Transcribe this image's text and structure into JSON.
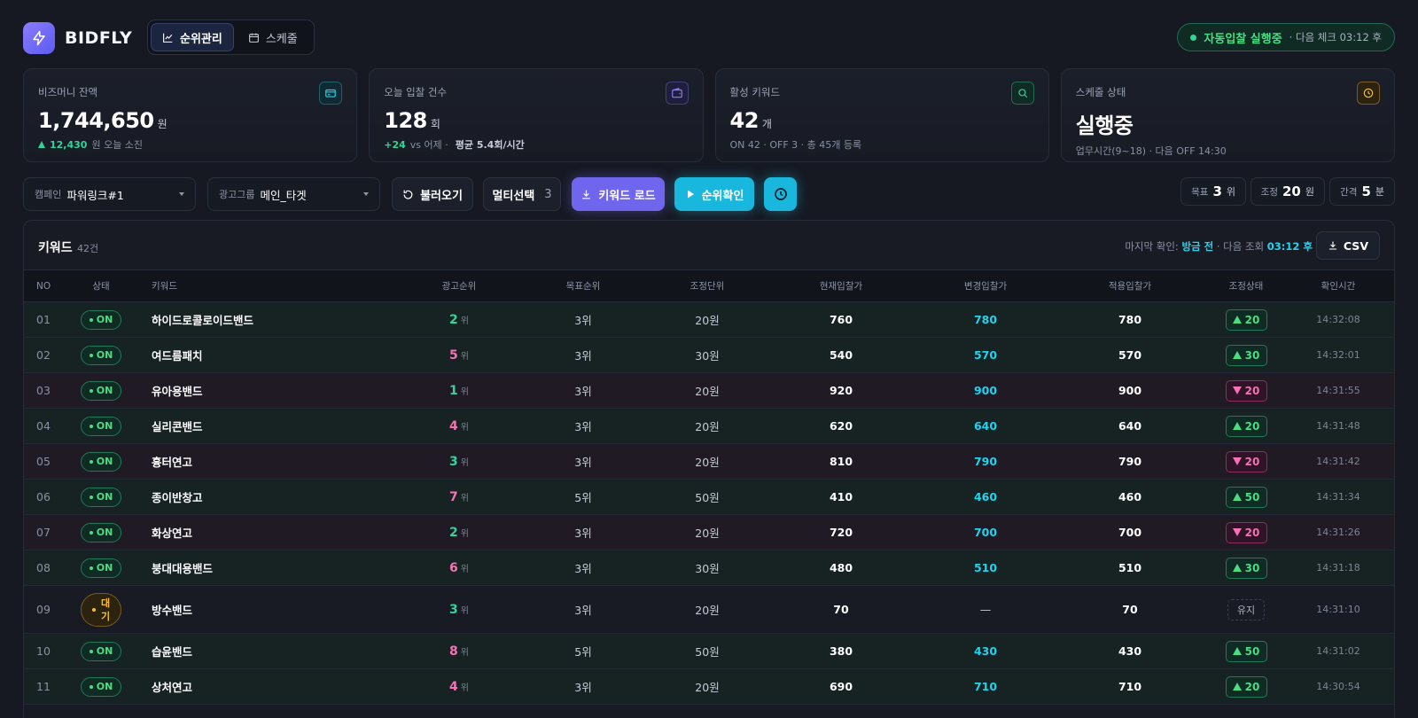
{
  "app": {
    "brand": "BIDFLY",
    "tabs": [
      {
        "label": "순위관리",
        "icon": "chart-line-icon",
        "active": true
      },
      {
        "label": "스케줄",
        "icon": "calendar-icon",
        "active": false
      }
    ],
    "status": {
      "main": "자동입찰 실행중",
      "sub": "· 다음 체크 03:12 후"
    }
  },
  "cards": [
    {
      "label": "비즈머니 잔액",
      "value": "1,744,650",
      "unit": "원",
      "sub_value": "12,430",
      "sub_text": "원 오늘 소진",
      "icon": "card-icon",
      "accent": "#22d3ee"
    },
    {
      "label": "오늘 입찰 건수",
      "value": "128",
      "unit": "회",
      "sub_value": "+24",
      "sub_text": "vs 어제 ·",
      "sub_extra": "평균 5.4회/시간",
      "icon": "wallet-icon",
      "accent": "#8b7cff"
    },
    {
      "label": "활성 키워드",
      "value": "42",
      "unit": "개",
      "sub_text": "ON 42 · OFF 3 · 총 45개 등록",
      "icon": "search-icon",
      "accent": "#34d399"
    },
    {
      "label": "스케줄 상태",
      "value": "실행중",
      "sub_text": "업무시간(9~18) · 다음 OFF 14:30",
      "icon": "clock-icon",
      "accent": "#fbbf24"
    }
  ],
  "toolbar": {
    "campaign_label": "캠페인",
    "campaign_value": "파워링크#1",
    "group_label": "광고그룹",
    "group_value": "메인_타겟",
    "load_label": "불러오기",
    "multi_label": "멀티선택",
    "multi_count": "3",
    "keyword_load_label": "키워드 로드",
    "rank_check_label": "순위확인",
    "chips": [
      {
        "label": "목표",
        "value": "3",
        "unit": "위"
      },
      {
        "label": "조정",
        "value": "20",
        "unit": "원"
      },
      {
        "label": "간격",
        "value": "5",
        "unit": "분"
      }
    ]
  },
  "table": {
    "title": "키워드",
    "count": "42건",
    "last_check_prefix": "마지막 확인:",
    "last_check_value": "방금 전",
    "next_check_prefix": "· 다음 조회",
    "next_check_value": "03:12 후",
    "csv_label": "CSV",
    "columns": [
      "NO",
      "상태",
      "키워드",
      "광고순위",
      "목표순위",
      "조정단위",
      "현재입찰가",
      "변경입찰가",
      "적용입찰가",
      "조정상태",
      "확인시간"
    ],
    "rank_unit": "위",
    "rows": [
      {
        "no": "01",
        "state": "ON",
        "keyword": "하이드로콜로이드밴드",
        "rank": "2",
        "goal": "3위",
        "unit": "20원",
        "current": "760",
        "changed": "780",
        "applied": "780",
        "adj_dir": "up",
        "adj": "20",
        "time": "14:32:08"
      },
      {
        "no": "02",
        "state": "ON",
        "keyword": "여드름패치",
        "rank": "5",
        "goal": "3위",
        "unit": "30원",
        "current": "540",
        "changed": "570",
        "applied": "570",
        "adj_dir": "up",
        "adj": "30",
        "time": "14:32:01"
      },
      {
        "no": "03",
        "state": "ON",
        "keyword": "유아용밴드",
        "rank": "1",
        "goal": "3위",
        "unit": "20원",
        "current": "920",
        "changed": "900",
        "applied": "900",
        "adj_dir": "down",
        "adj": "20",
        "time": "14:31:55"
      },
      {
        "no": "04",
        "state": "ON",
        "keyword": "실리콘밴드",
        "rank": "4",
        "goal": "3위",
        "unit": "20원",
        "current": "620",
        "changed": "640",
        "applied": "640",
        "adj_dir": "up",
        "adj": "20",
        "time": "14:31:48"
      },
      {
        "no": "05",
        "state": "ON",
        "keyword": "흉터연고",
        "rank": "3",
        "goal": "3위",
        "unit": "20원",
        "current": "810",
        "changed": "790",
        "applied": "790",
        "adj_dir": "down",
        "adj": "20",
        "time": "14:31:42"
      },
      {
        "no": "06",
        "state": "ON",
        "keyword": "종이반창고",
        "rank": "7",
        "goal": "5위",
        "unit": "50원",
        "current": "410",
        "changed": "460",
        "applied": "460",
        "adj_dir": "up",
        "adj": "50",
        "time": "14:31:34"
      },
      {
        "no": "07",
        "state": "ON",
        "keyword": "화상연고",
        "rank": "2",
        "goal": "3위",
        "unit": "20원",
        "current": "720",
        "changed": "700",
        "applied": "700",
        "adj_dir": "down",
        "adj": "20",
        "time": "14:31:26"
      },
      {
        "no": "08",
        "state": "ON",
        "keyword": "붕대대용밴드",
        "rank": "6",
        "goal": "3위",
        "unit": "30원",
        "current": "480",
        "changed": "510",
        "applied": "510",
        "adj_dir": "up",
        "adj": "30",
        "time": "14:31:18"
      },
      {
        "no": "09",
        "state": "대기",
        "state_line1": "대",
        "state_line2": "기",
        "keyword": "방수밴드",
        "rank": "3",
        "goal": "3위",
        "unit": "20원",
        "current": "70",
        "changed": "—",
        "applied": "70",
        "adj_dir": "keep",
        "adj": "유지",
        "time": "14:31:10"
      },
      {
        "no": "10",
        "state": "ON",
        "keyword": "습윤밴드",
        "rank": "8",
        "goal": "5위",
        "unit": "50원",
        "current": "380",
        "changed": "430",
        "applied": "430",
        "adj_dir": "up",
        "adj": "50",
        "time": "14:31:02"
      },
      {
        "no": "11",
        "state": "ON",
        "keyword": "상처연고",
        "rank": "4",
        "goal": "3위",
        "unit": "20원",
        "current": "690",
        "changed": "710",
        "applied": "710",
        "adj_dir": "up",
        "adj": "20",
        "time": "14:30:54"
      }
    ]
  }
}
